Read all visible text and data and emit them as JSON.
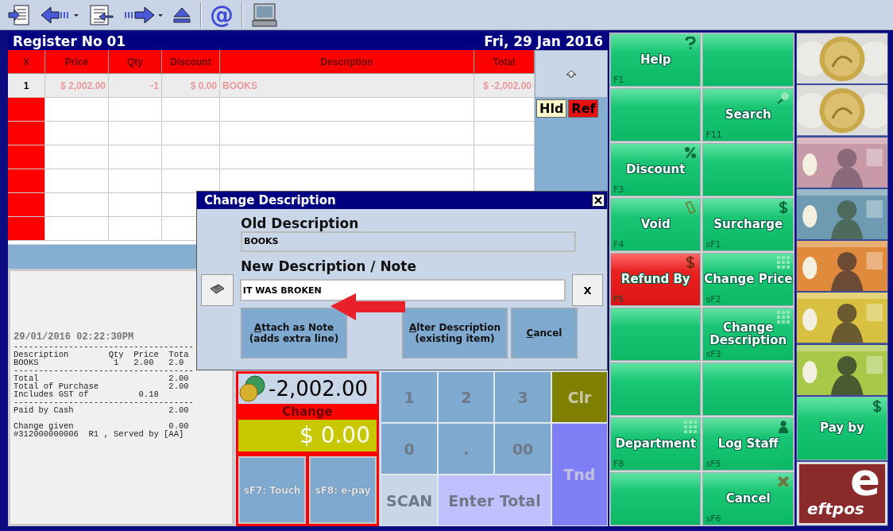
{
  "toolbar": {
    "at_label": "@"
  },
  "register": {
    "title": "Register No 01",
    "date": "Fri, 29 Jan 2016"
  },
  "table": {
    "columns": [
      "X",
      "Price",
      "Qty",
      "Discount",
      "Description",
      "Total"
    ],
    "rows": [
      {
        "cells": [
          "1",
          "$ 2,002.00",
          "-1",
          "$ 0.00",
          "BOOKS",
          "$ -2,002.00"
        ]
      }
    ]
  },
  "side": {
    "hold": "Hld",
    "refund": "Ref"
  },
  "receipt": {
    "lines": [
      "29/01/2016 02:22:30PM",
      "------------------------------------",
      "Description        Qty  Price  Tota",
      "BOOKS               1   2.00   2.0",
      "------------------------------------",
      "Total                          2.00",
      "Total of Purchase              2.00",
      "Includes GST of          0.18",
      "------------------------------------",
      "Paid by Cash                   2.00",
      "Change given                   0.00",
      "#312000000006  R1 , Served by [AA]"
    ]
  },
  "dialog": {
    "title": "Change Description",
    "old_label": "Old Description",
    "old_value": "BOOKS",
    "new_label": "New Description / Note",
    "new_value": "IT WAS BROKEN",
    "clear_label": "X",
    "buttons": [
      {
        "accel": "A",
        "rest": "ttach as Note",
        "line2": "(adds extra line)"
      },
      {
        "accel": "A",
        "rest": "lter Description",
        "line2": "(existing item)"
      },
      {
        "accel": "C",
        "rest": "ancel"
      }
    ]
  },
  "tender": {
    "amount": "-2,002.00",
    "change_label": "Change",
    "change_value": "$ 0.00",
    "buttons": [
      "sF7: Touch",
      "sF8: e-pay"
    ]
  },
  "keypad": [
    {
      "label": "1",
      "kind": "digit"
    },
    {
      "label": "2",
      "kind": "digit"
    },
    {
      "label": "3",
      "kind": "digit"
    },
    {
      "label": "Clr",
      "kind": "clear"
    },
    {
      "label": "0",
      "kind": "digit"
    },
    {
      "label": ".",
      "kind": "digit"
    },
    {
      "label": "00",
      "kind": "digit"
    },
    {
      "label": "Tnd",
      "kind": "tender"
    },
    {
      "label": "SCAN",
      "kind": "scan"
    },
    {
      "label": "Enter Total",
      "kind": "total"
    }
  ],
  "functions": [
    {
      "kind": "green",
      "label": "Help",
      "key": "F1"
    },
    {
      "kind": "green"
    },
    {
      "kind": "green"
    },
    {
      "kind": "green",
      "label": "Search",
      "key": "F11"
    },
    {
      "kind": "green",
      "label": "Discount",
      "key": "F3"
    },
    {
      "kind": "green"
    },
    {
      "kind": "green",
      "label": "Void",
      "key": "F4"
    },
    {
      "kind": "green",
      "label": "Surcharge",
      "key": "sF1"
    },
    {
      "kind": "red",
      "label": "Refund By",
      "key": "F5"
    },
    {
      "kind": "green",
      "label": "Change Price",
      "key": "sF2"
    },
    {
      "kind": "green"
    },
    {
      "kind": "green",
      "label": "Change Description",
      "key": "sF3"
    },
    {
      "kind": "green"
    },
    {
      "kind": "green"
    },
    {
      "kind": "green",
      "label": "Department",
      "key": "F8"
    },
    {
      "kind": "green",
      "label": "Log Staff",
      "key": "sF5"
    },
    {
      "kind": "green"
    },
    {
      "kind": "green",
      "label": "Cancel",
      "key": "sF6"
    }
  ],
  "money": {
    "pay_label": "Pay by",
    "eftpos_mark": "e",
    "eftpos_text": "eftpos"
  }
}
